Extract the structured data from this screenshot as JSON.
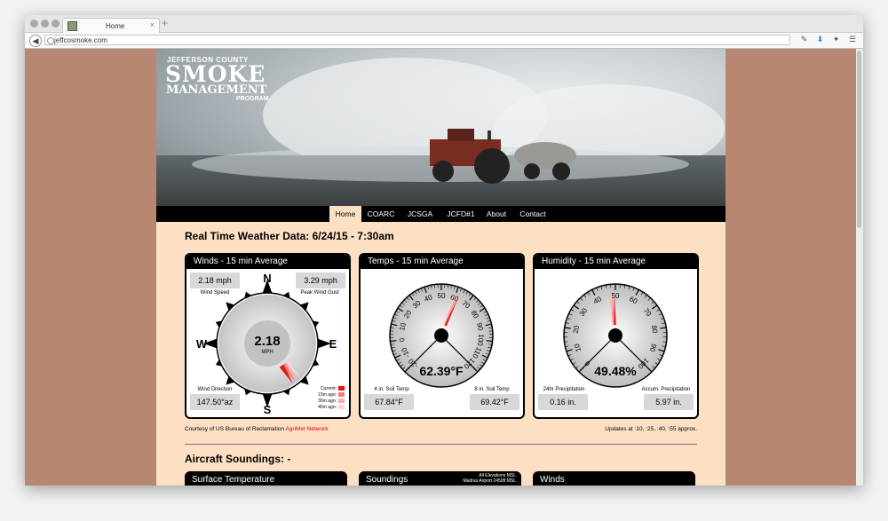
{
  "browser": {
    "tab_title": "Home",
    "tab_close": "×",
    "new_tab": "+",
    "url": "jeffcosmoke.com"
  },
  "banner": {
    "line1": "JEFFERSON COUNTY",
    "line2": "SMOKE",
    "line3": "MANAGEMENT",
    "line4": "PROGRAM"
  },
  "nav": {
    "items": [
      {
        "label": "Home",
        "active": true
      },
      {
        "label": "COARC",
        "active": false
      },
      {
        "label": "JCSGA",
        "active": false
      },
      {
        "label": "JCFD#1",
        "active": false
      },
      {
        "label": "About",
        "active": false
      },
      {
        "label": "Contact",
        "active": false
      }
    ]
  },
  "weather": {
    "heading": "Real Time Weather Data: 6/24/15 - 7:30am",
    "winds": {
      "title": "Winds - 15 min Average",
      "wind_speed": "2.18 mph",
      "wind_speed_label": "Wind Speed",
      "peak_gust": "3.29 mph",
      "peak_gust_label": "Peak Wind Gust",
      "center_value": "2.18",
      "center_unit": "MPH",
      "dir_n": "N",
      "dir_s": "S",
      "dir_e": "E",
      "dir_w": "W",
      "direction_label": "Wind Direction",
      "direction_value": "147.50°az",
      "direction_deg": 147.5,
      "legend": [
        "Current:",
        "15m ago:",
        "30m ago:",
        "45m ago:"
      ]
    },
    "temps": {
      "title": "Temps - 15 min Average",
      "ticks": [
        "-20",
        "-10",
        "0",
        "10",
        "20",
        "30",
        "40",
        "50",
        "60",
        "70",
        "80",
        "90",
        "100",
        "110",
        "120"
      ],
      "value_deg": 62.39,
      "value_text": "62.39°F",
      "soil4_label": "4 in. Soil Temp",
      "soil4_value": "67.84°F",
      "soil8_label": "8 in. Soil Temp",
      "soil8_value": "69.42°F"
    },
    "humidity": {
      "title": "Humidity - 15 min Average",
      "ticks": [
        "0",
        "10",
        "20",
        "30",
        "40",
        "50",
        "60",
        "70",
        "80",
        "90",
        "100"
      ],
      "value_pct": 49.48,
      "value_text": "49.48%",
      "precip24_label": "24hr Precipitation",
      "precip24_value": "0.16 in.",
      "accum_label": "Accum. Precipitation",
      "accum_value": "5.97 in."
    },
    "courtesy_text": "Courtesy of US Bureau of Reclamation ",
    "courtesy_link": "AgriMet Network",
    "updates": "Updates at :10, :25, :40, :55 approx."
  },
  "aircraft": {
    "heading": "Aircraft Soundings: -",
    "panels": [
      {
        "title": "Surface Temperature"
      },
      {
        "title": "Soundings",
        "note1": "All Elevations MSL",
        "note2": "Madras Airport 2450ft MSL"
      },
      {
        "title": "Winds"
      }
    ]
  },
  "colors": {
    "page_bg": "#b78772",
    "content_bg": "#fde0c4",
    "needle": "#ee1111"
  }
}
